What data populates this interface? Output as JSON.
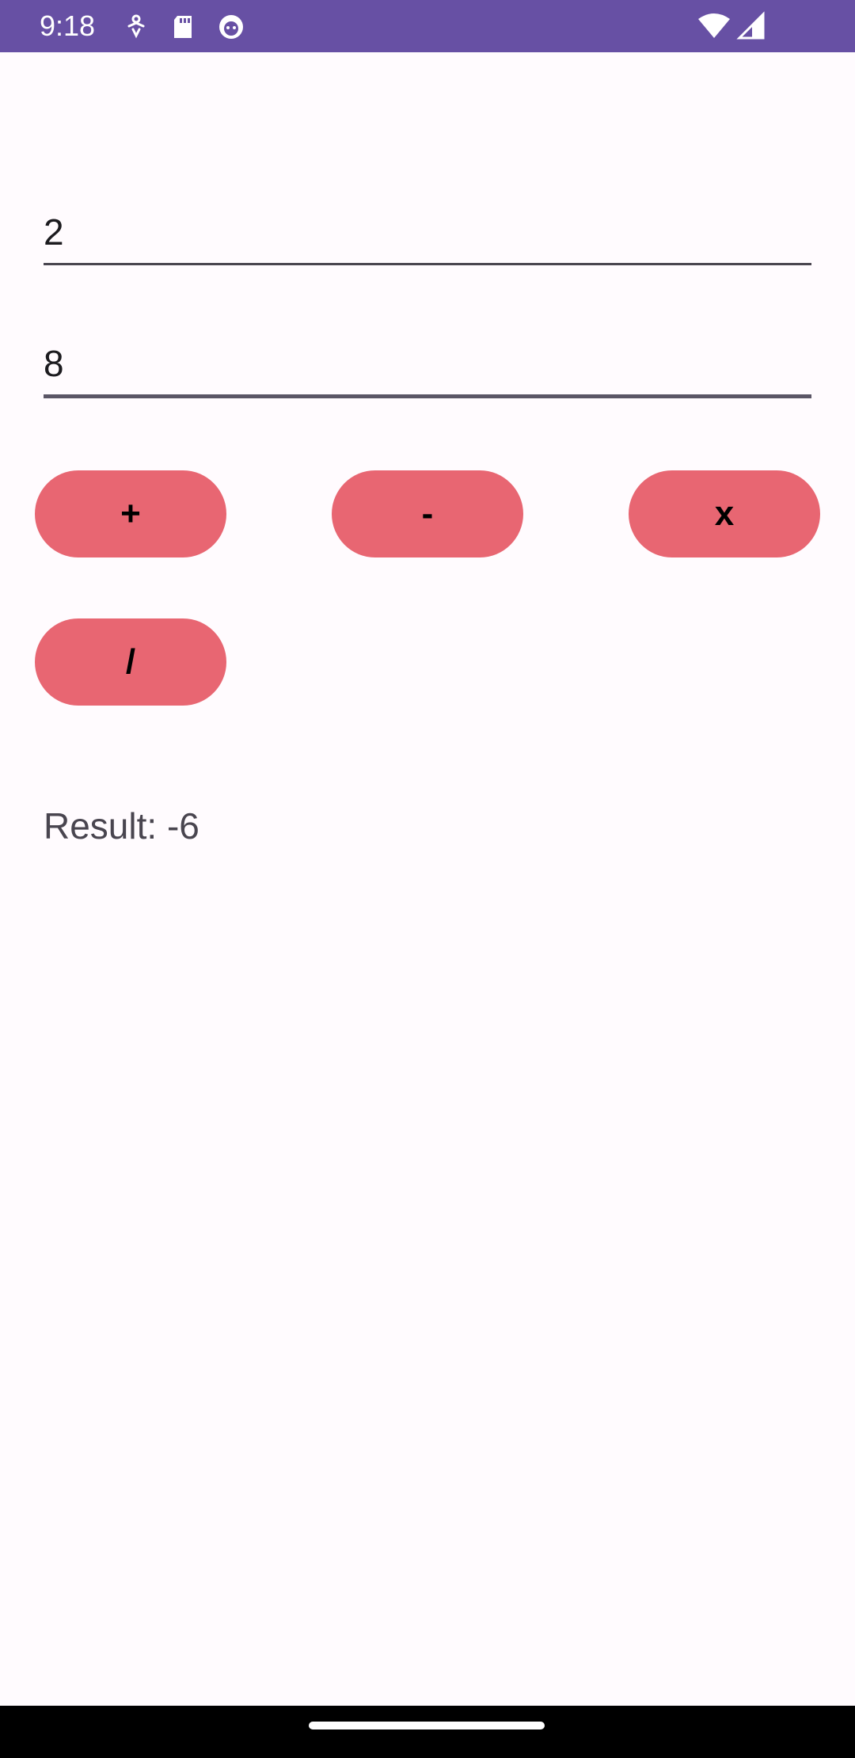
{
  "status_bar": {
    "time": "9:18",
    "icons": [
      "accessibility-icon",
      "sd-card-icon",
      "debug-icon",
      "wifi-icon",
      "signal-icon"
    ],
    "background": "#6750A4"
  },
  "inputs": {
    "first_number": "2",
    "second_number": "8"
  },
  "buttons": {
    "add": "+",
    "subtract": "-",
    "multiply": "x",
    "divide": "/",
    "color": "#E86672"
  },
  "result": {
    "text": "Result: -6"
  }
}
